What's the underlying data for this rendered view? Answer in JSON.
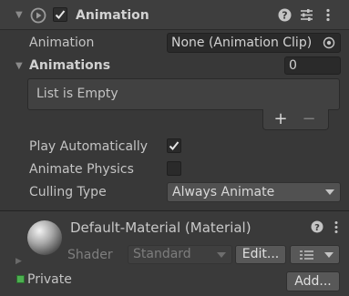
{
  "component": {
    "title": "Animation",
    "enabled": true,
    "icons": [
      "play-circle-icon",
      "help-icon",
      "preset-icon",
      "kebab-menu-icon"
    ]
  },
  "animation_field": {
    "label": "Animation",
    "value": "None (Animation Clip)"
  },
  "animations_list": {
    "label": "Animations",
    "size": "0",
    "empty_text": "List is Empty",
    "add_symbol": "+",
    "remove_symbol": "−"
  },
  "play_automatically": {
    "label": "Play Automatically",
    "checked": true
  },
  "animate_physics": {
    "label": "Animate Physics",
    "checked": false
  },
  "culling_type": {
    "label": "Culling Type",
    "value": "Always Animate"
  },
  "material": {
    "title": "Default-Material (Material)",
    "shader_label": "Shader",
    "shader_value": "Standard",
    "edit_label": "Edit...",
    "private_label": "Private",
    "add_label": "Add..."
  },
  "colors": {
    "background": "#383838",
    "header": "#3e3e3e",
    "field": "#2a2a2a",
    "private_marker": "#4caf50"
  }
}
